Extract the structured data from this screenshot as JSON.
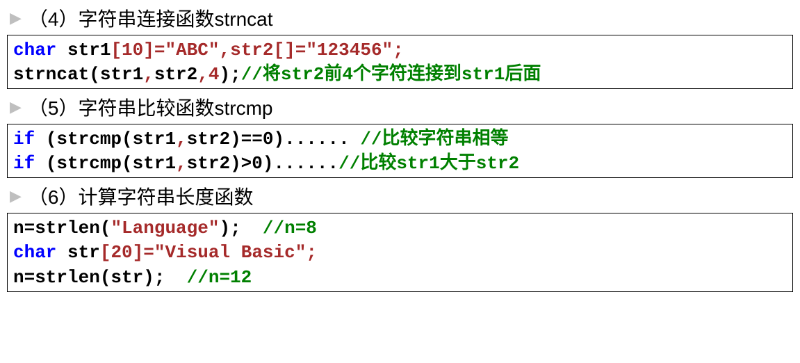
{
  "sections": [
    {
      "heading": "（4）字符串连接函数strncat",
      "code": {
        "l1": {
          "kw": "char",
          "t1": " str1",
          "br1": "[",
          "n1": "10",
          "br2": "]=",
          "s1": "\"ABC\"",
          "c1": ",str2",
          "br3": "[]=",
          "s2": "\"123456\"",
          "e1": ";"
        },
        "l2": {
          "t1": "strncat(str1",
          "c1": ",",
          "t2": "str2",
          "c2": ",",
          "n1": "4",
          "t3": ");",
          "cm": "//将str2前4个字符连接到str1后面"
        }
      }
    },
    {
      "heading": "（5）字符串比较函数strcmp",
      "code": {
        "l1": {
          "kw": "if",
          "t1": " (strcmp(str1",
          "c1": ",",
          "t2": "str2)==0)...... ",
          "cm": "//比较字符串相等"
        },
        "l2": {
          "kw": "if",
          "t1": " (strcmp(str1",
          "c1": ",",
          "t2": "str2)>0)......",
          "cm": "//比较str1大于str2"
        }
      }
    },
    {
      "heading": "（6）计算字符串长度函数",
      "code": {
        "l1": {
          "t1": "n=strlen(",
          "s1": "\"Language\"",
          "t2": ");  ",
          "cm": "//n=8"
        },
        "l2": {
          "kw": "char",
          "t1": " str",
          "br1": "[",
          "n1": "20",
          "br2": "]=",
          "s1": "\"Visual Basic\"",
          "e1": ";"
        },
        "l3": {
          "t1": "n=strlen(str);  ",
          "cm": "//n=12"
        }
      }
    }
  ]
}
